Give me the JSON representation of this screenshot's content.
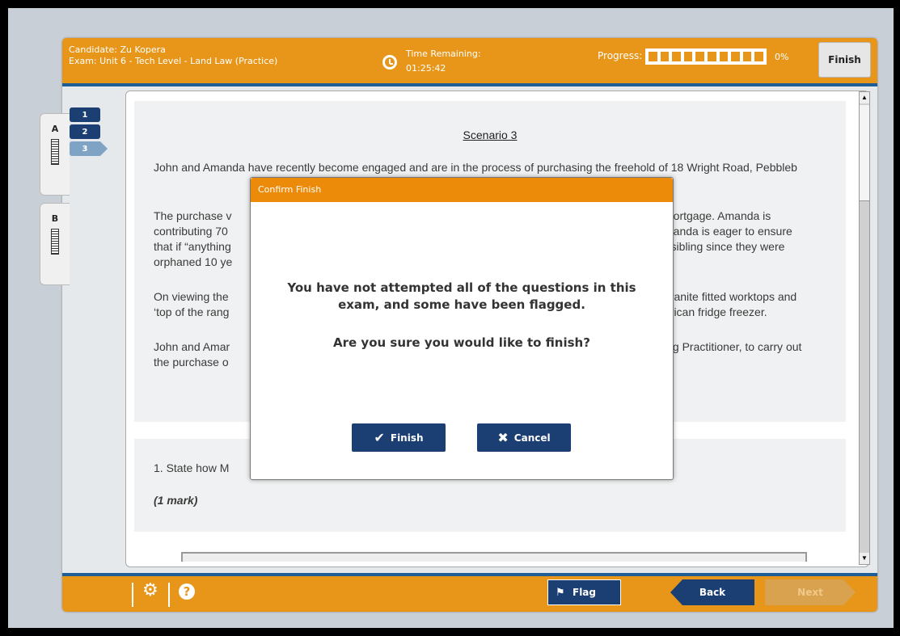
{
  "header": {
    "candidate": "Candidate: Zu Kopera",
    "exam": "Exam: Unit 6 - Tech Level - Land Law (Practice)",
    "time_label": "Time Remaining:",
    "time_value": "01:25:42",
    "progress_label": "Progress:",
    "progress_pct": "0%",
    "progress_fraction": 0,
    "finish_label": "Finish"
  },
  "sections": [
    {
      "label": "A"
    },
    {
      "label": "B"
    }
  ],
  "questions": [
    "1",
    "2",
    "3"
  ],
  "current_question": "3",
  "scenario": {
    "title": "Scenario 3",
    "paragraphs": [
      "John and Amanda have recently become engaged and are in the process of purchasing the freehold of 18 Wright Road, Pebbleb",
      "The purchase v",
      "contributing 70",
      "that if “anything",
      "orphaned 10 ye",
      "On viewing the",
      "‘top of the rang",
      "John and Amar",
      "the purchase o"
    ],
    "paragraph_right": [
      "mortgage. Amanda is",
      "manda is eager to ensure",
      "r sibling since they were",
      "granite fitted worktops and",
      "erican fridge freezer.",
      "ing Practitioner, to carry out"
    ]
  },
  "question": {
    "text": "1.  State how M",
    "marks": "(1 mark)"
  },
  "footer": {
    "flag_label": "Flag",
    "back_label": "Back",
    "next_label": "Next"
  },
  "modal": {
    "title": "Confirm Finish",
    "message_line1": "You have not attempted all of the questions in this",
    "message_line2": "exam, and some have been flagged.",
    "question": "Are you sure you would like to finish?",
    "finish_label": "Finish",
    "cancel_label": "Cancel"
  },
  "colors": {
    "accent": "#e8961a",
    "navy": "#1b3f72"
  }
}
